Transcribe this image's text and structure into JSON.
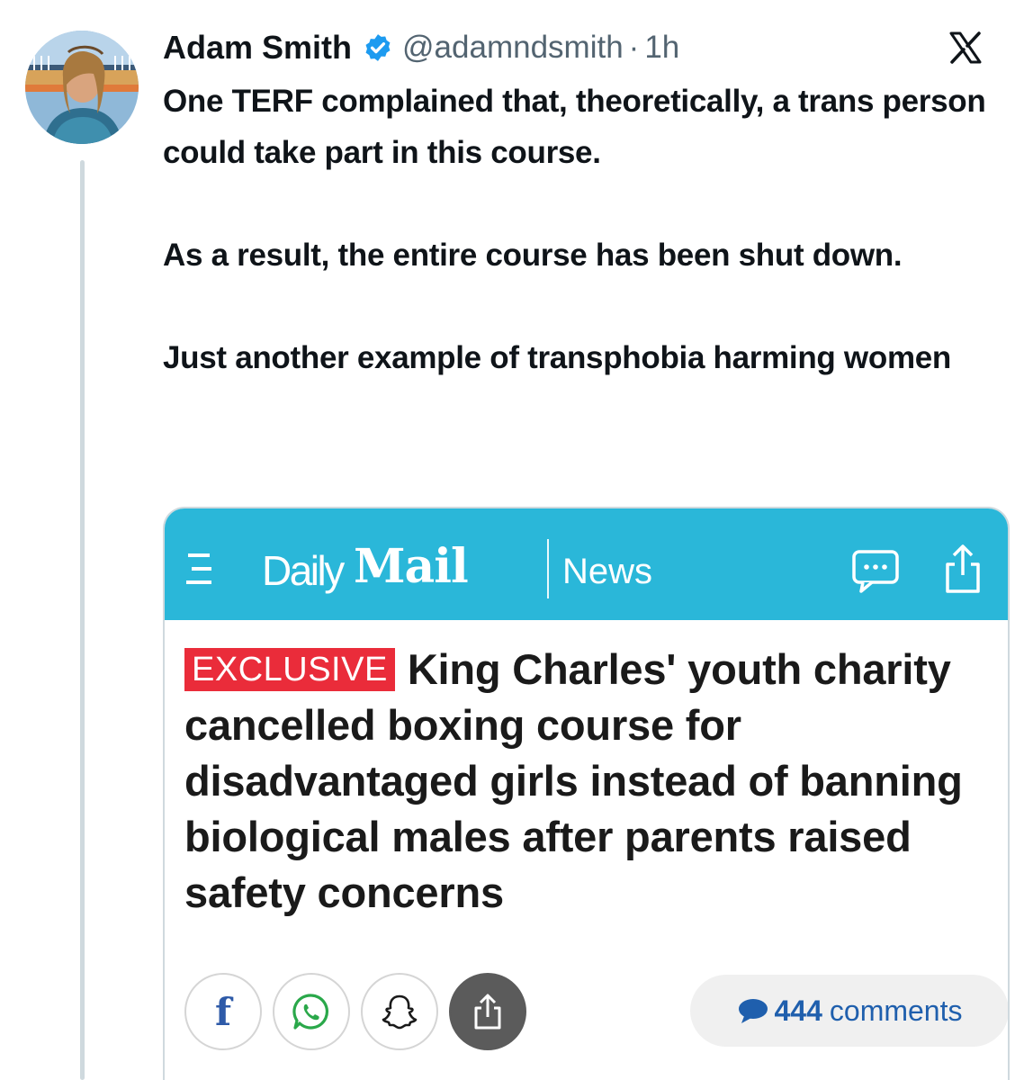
{
  "tweet": {
    "display_name": "Adam Smith",
    "handle": "@adamndsmith",
    "separator": "·",
    "time": "1h",
    "paragraphs": [
      "One TERF complained that, theoretically, a trans person could take part in this course.",
      "As a result, the entire course has been shut down.",
      "Just another example of transphobia harming women"
    ],
    "icons": {
      "verified": "verified-badge-icon",
      "platform": "x-logo-icon"
    },
    "colors": {
      "verified": "#1d9bf0",
      "secondary_text": "#536471",
      "thread_line": "#cfd9de"
    }
  },
  "article": {
    "brand_daily": "Daily",
    "brand_mail": "Mail",
    "section": "News",
    "tag": "EXCLUSIVE",
    "headline": "King Charles' youth charity cancelled boxing course for disadvantaged girls instead of banning biological males after parents raised safety concerns",
    "comments_count": "444",
    "comments_label": "comments",
    "icons": [
      "menu-icon",
      "comment-icon",
      "share-icon",
      "facebook-icon",
      "whatsapp-icon",
      "snapchat-icon",
      "share-icon"
    ],
    "colors": {
      "header_bar": "#2ab7d9",
      "exclusive_bg": "#ea2c3a",
      "comments_text": "#1f5fad"
    }
  }
}
